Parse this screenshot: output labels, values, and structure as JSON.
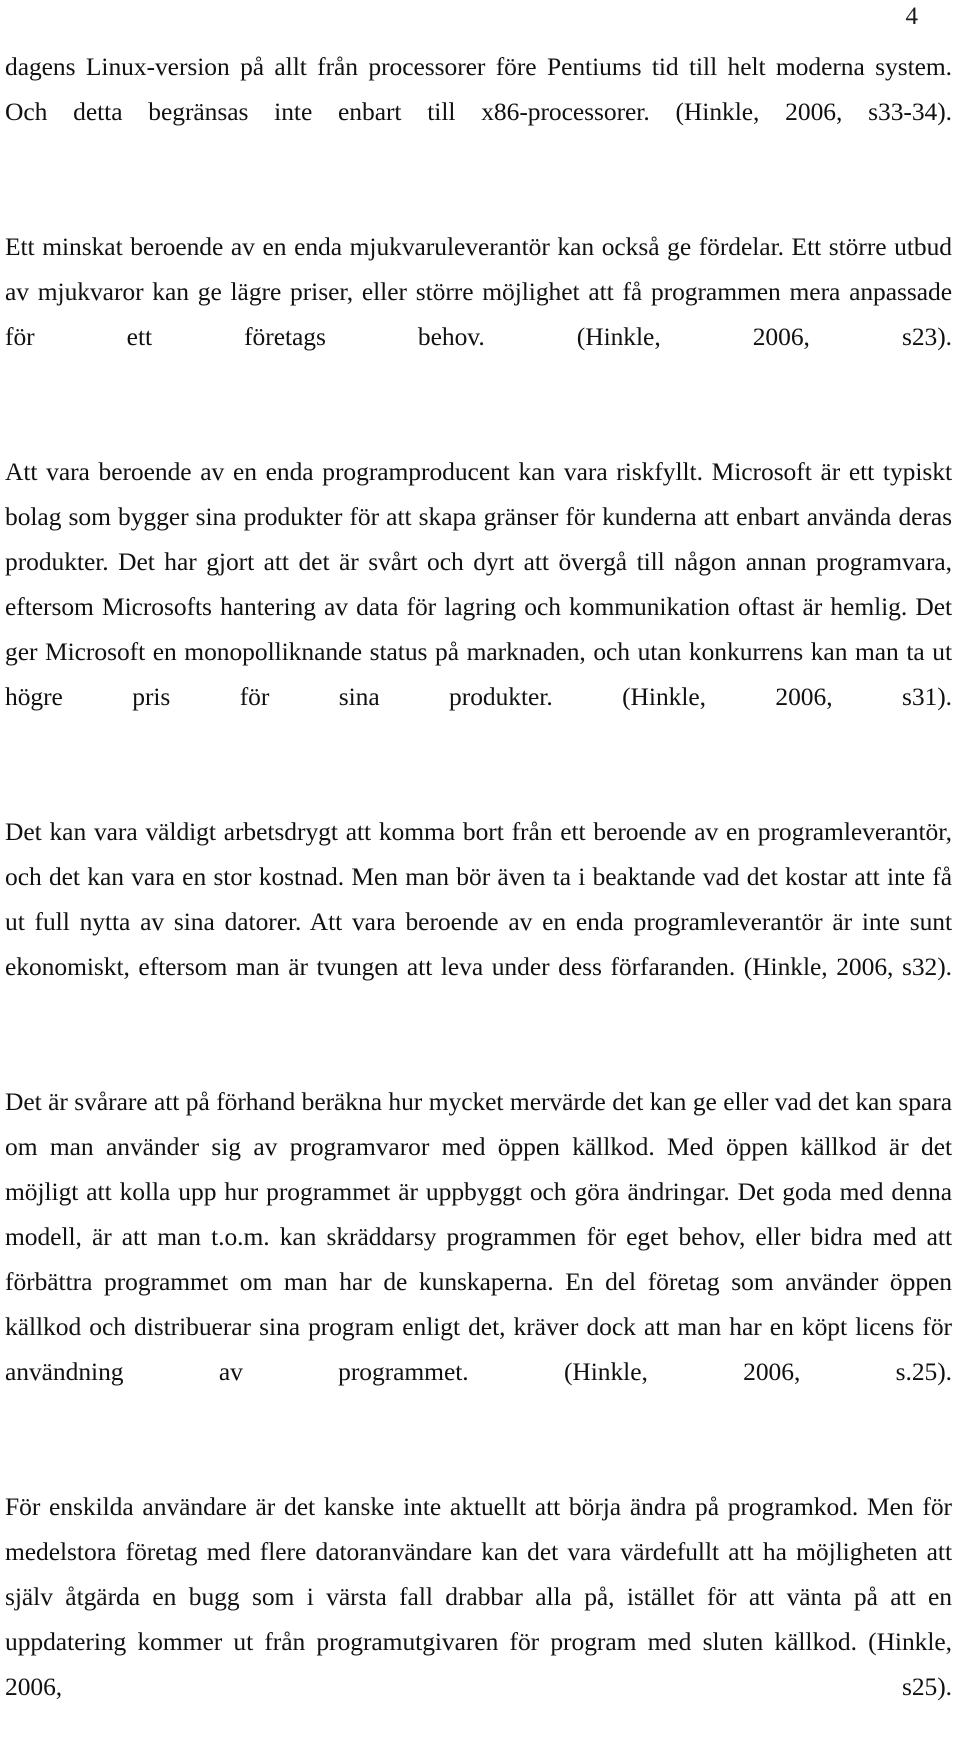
{
  "document": {
    "page_number": "4",
    "language": "sv",
    "paragraphs": [
      {
        "id": "p1",
        "text": "dagens Linux-version på allt från processorer före Pentiums tid till helt moderna system. Och detta begränsas inte enbart till x86-processorer. (Hinkle, 2006, s33-34)."
      },
      {
        "id": "p2",
        "text": "Ett minskat beroende av en enda mjukvaruleverantör kan också ge fördelar. Ett större utbud av mjukvaror kan ge lägre priser, eller större möjlighet att få programmen mera anpassade för ett företags behov. (Hinkle, 2006, s23)."
      },
      {
        "id": "p3",
        "text": "Att vara beroende av en enda programproducent kan vara riskfyllt. Microsoft är ett typiskt bolag som bygger sina produkter för att skapa gränser för kunderna att enbart använda deras produkter. Det har gjort att det är svårt och dyrt att övergå till någon annan programvara, eftersom Microsofts hantering av data för lagring och kommunikation oftast är hemlig. Det ger Microsoft en monopolliknande status på marknaden, och utan konkurrens kan man ta ut högre pris för sina produkter. (Hinkle, 2006, s31)."
      },
      {
        "id": "p4",
        "text": "Det kan vara väldigt arbetsdrygt att komma bort från ett beroende av en programleverantör, och det kan vara en stor kostnad. Men man bör även ta i beaktande vad det kostar att inte få ut full nytta av sina datorer. Att vara beroende av en enda programleverantör är inte sunt ekonomiskt, eftersom man är tvungen att leva under dess förfaranden. (Hinkle, 2006, s32)."
      },
      {
        "id": "p5",
        "text": "Det är svårare att på förhand beräkna hur mycket mervärde det kan ge eller vad det kan spara om man använder sig av programvaror med öppen källkod. Med öppen källkod är det möjligt att kolla upp hur programmet är uppbyggt och göra ändringar. Det goda med denna modell, är att man t.o.m. kan skräddarsy programmen för eget behov, eller bidra med att förbättra programmet om man har de kunskaperna. En del företag som använder öppen källkod och distribuerar sina program enligt det, kräver dock att man har en köpt licens för användning av programmet. (Hinkle, 2006, s.25)."
      },
      {
        "id": "p6",
        "text": "För enskilda användare är det kanske inte aktuellt att börja ändra på programkod. Men för medelstora företag med flere datoranvändare kan det vara värdefullt att ha möjligheten att själv åtgärda en bugg som i värsta fall drabbar alla på, istället för att vänta på att en uppdatering kommer ut från programutgivaren för program med sluten källkod. (Hinkle, 2006, s25)."
      }
    ]
  }
}
